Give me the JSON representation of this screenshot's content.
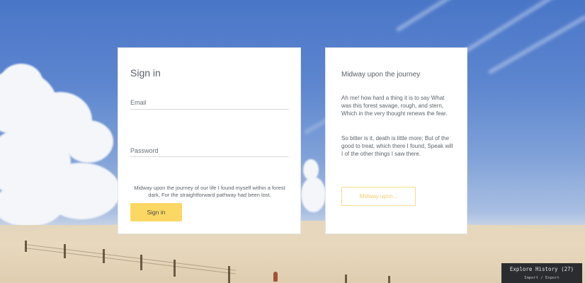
{
  "signin": {
    "title": "Sign in",
    "email_label": "Email",
    "password_label": "Password",
    "note": "Midway upon the journey of our life I found myself within a forest dark, For the straightforward pathway had been lost.",
    "button_label": "Sign in"
  },
  "info": {
    "title": "Midway upon the journey",
    "paragraph1": "Ah me! how hard a thing it is to say What was this forest savage, rough, and stern, Which in the very thought renews the fear.",
    "paragraph2": "So bitter is it, death is little more; But of the good to treat, which there I found, Speak will I of the other things I saw there.",
    "button_label": "Midway upon..."
  },
  "history": {
    "title": "Explore History (27)",
    "subtitle": "Import / Export"
  },
  "colors": {
    "accent": "#fbd864",
    "sky": "#4a76c8",
    "sand": "#e3d5bd"
  }
}
